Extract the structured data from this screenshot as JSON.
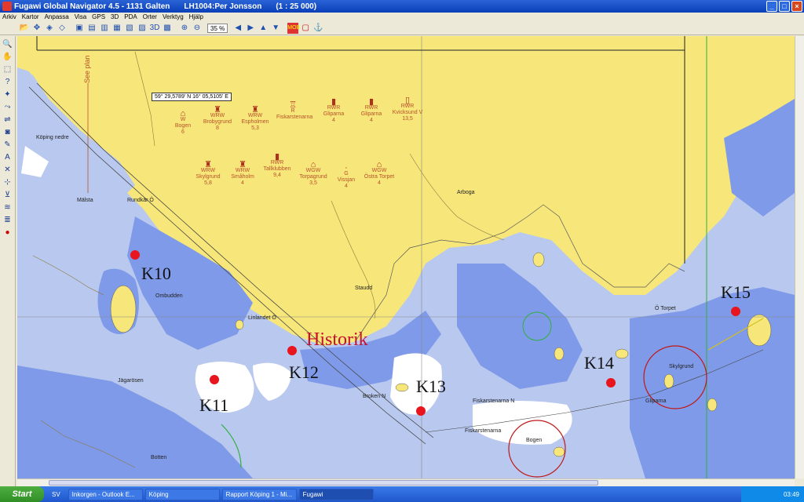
{
  "window": {
    "title": "Fugawi Global Navigator 4.5 - 1131 Galten",
    "document": "LH1004:Per Jonsson",
    "scale": "(1 : 25 000)"
  },
  "menu": [
    "Arkiv",
    "Kartor",
    "Anpassa",
    "Visa",
    "GPS",
    "3D",
    "PDA",
    "Orter",
    "Verktyg",
    "Hjälp"
  ],
  "toolbar": {
    "zoom_value": "35 %"
  },
  "map": {
    "coordinate_readout": "59° 29,5789' N 16° 05,5105' E",
    "labels": {
      "k10": "K10",
      "k11": "K11",
      "k12": "K12",
      "k13": "K13",
      "k14": "K14",
      "k15": "K15",
      "historik": "Historik"
    },
    "legend_row1": [
      {
        "type": "W",
        "name": "Bogen",
        "range": "6"
      },
      {
        "type": "WRW",
        "name": "Brobygrund",
        "range": "8"
      },
      {
        "type": "WRW",
        "name": "Espholmen",
        "range": "5,3"
      },
      {
        "type": "R",
        "name": "Fiskarstenarna",
        "range": ""
      },
      {
        "type": "RWR",
        "name": "Gliparna",
        "range": "4"
      },
      {
        "type": "RWR",
        "name": "Gliparna",
        "range": "4"
      },
      {
        "type": "RWR",
        "name": "Kvicksund V",
        "range": "13,5"
      }
    ],
    "legend_row2": [
      {
        "type": "WRW",
        "name": "Skylgrund",
        "range": "5,8"
      },
      {
        "type": "WRW",
        "name": "Småholm",
        "range": "4"
      },
      {
        "type": "RWR",
        "name": "Tallklubben",
        "range": "9,4"
      },
      {
        "type": "WGW",
        "name": "Torpagrund",
        "range": "3,5"
      },
      {
        "type": "G",
        "name": "Vissjan",
        "range": "4"
      },
      {
        "type": "WGW",
        "name": "Östra Torpet",
        "range": "4"
      }
    ],
    "see_plan": "See plan",
    "place_names": [
      "Köping nedre",
      "Rundkär Ö",
      "Linlandet Ö",
      "Broken N",
      "Fiskarstenarna N",
      "Fiskarstenarna",
      "Skylgrund",
      "Gliparna",
      "Bogen",
      "Botten",
      "Ö Torpet",
      "Ombudden",
      "Jägarösen",
      "Staudd",
      "Arboga",
      "Mälsta"
    ]
  },
  "taskbar": {
    "start": "Start",
    "lang": "SV",
    "tasks": [
      "Inkorgen - Outlook E...",
      "Köping",
      "Rapport Köping 1 - Mi...",
      "Fugawi"
    ],
    "clock": "03:49"
  },
  "colors": {
    "land": "#f7e77a",
    "deep_water": "#b9c8ef",
    "shallow_water": "#7f9ae8",
    "very_shallow": "#ffffff",
    "marker": "#e8141e",
    "historik": "#c8102e"
  }
}
